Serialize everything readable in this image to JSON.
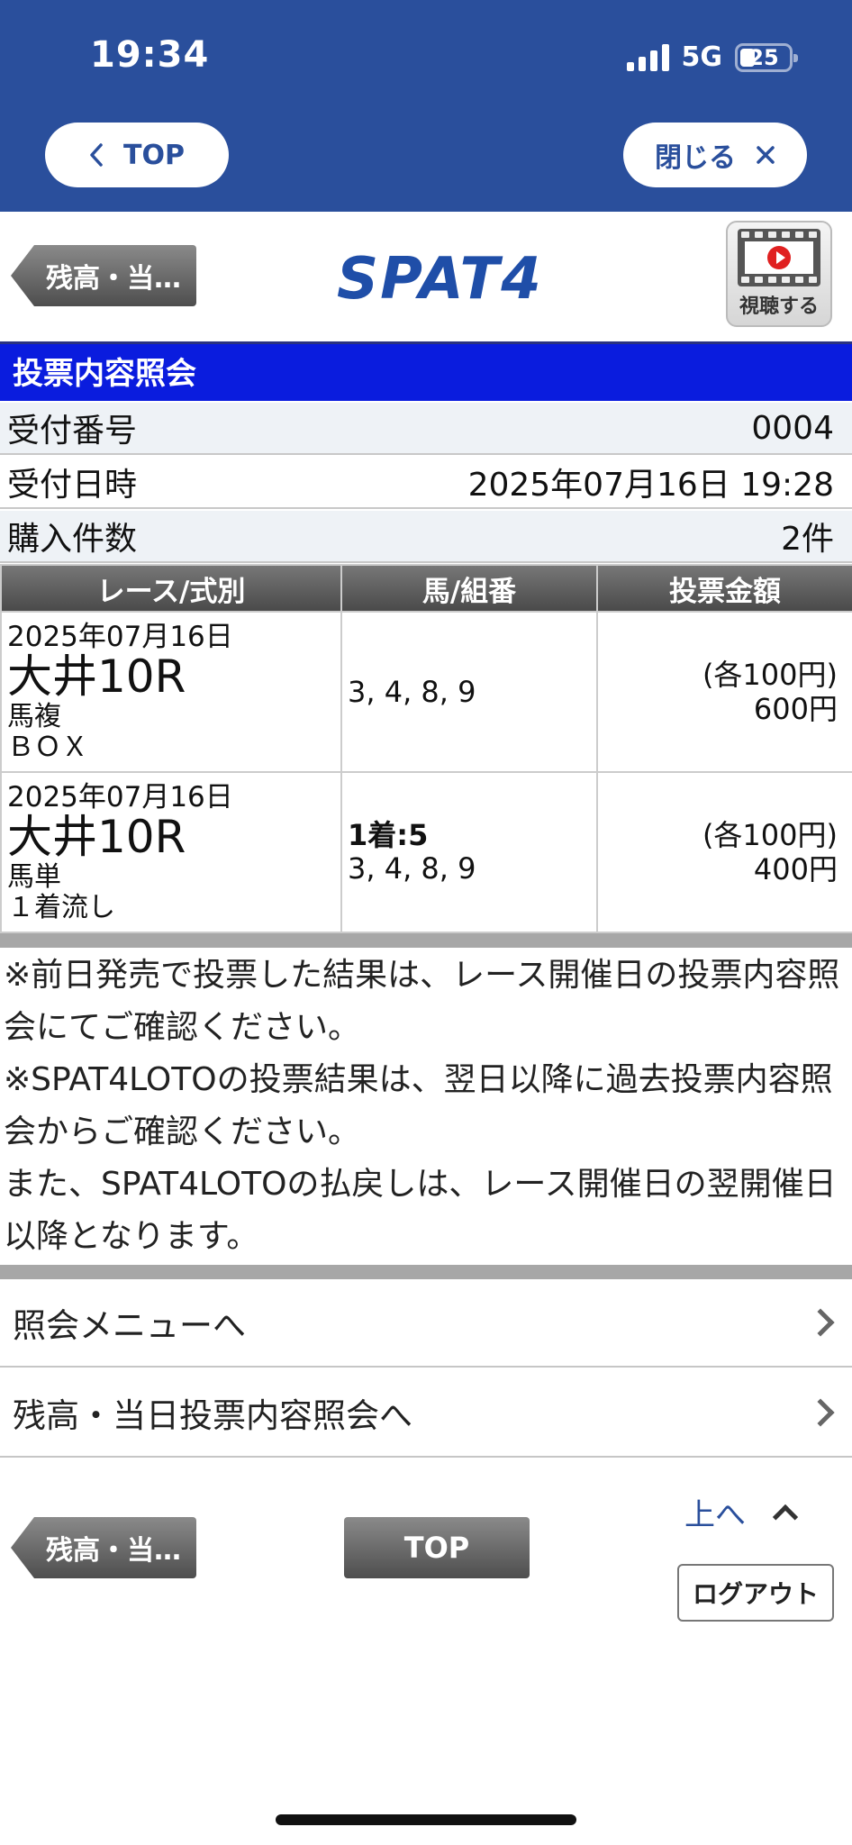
{
  "status_bar": {
    "time": "19:34",
    "network": "5G",
    "battery": "25"
  },
  "browser": {
    "top_label": "TOP",
    "close_label": "閉じる"
  },
  "header": {
    "back_label": "残高・当…",
    "logo": "SPAT4",
    "watch_label": "視聴する"
  },
  "section_title": "投票内容照会",
  "info": [
    {
      "label": "受付番号",
      "value": "0004"
    },
    {
      "label": "受付日時",
      "value": "2025年07月16日 19:28"
    },
    {
      "label": "購入件数",
      "value": "2件"
    }
  ],
  "table": {
    "headers": [
      "レース/式別",
      "馬/組番",
      "投票金額"
    ],
    "rows": [
      {
        "date": "2025年07月16日",
        "venue": "大井10R",
        "type": "馬複",
        "method": "ＢＯＸ",
        "anchor": "",
        "combo": "3, 4, 8, 9",
        "unit": "(各100円)",
        "total": "600円"
      },
      {
        "date": "2025年07月16日",
        "venue": "大井10R",
        "type": "馬単",
        "method": "１着流し",
        "anchor": "1着:5",
        "combo": "3, 4, 8, 9",
        "unit": "(各100円)",
        "total": "400円"
      }
    ]
  },
  "notes": [
    "※前日発売で投票した結果は、レース開催日の投票内容照会にてご確認ください。",
    "※SPAT4LOTOの投票結果は、翌日以降に過去投票内容照会からご確認ください。",
    "また、SPAT4LOTOの払戻しは、レース開催日の翌開催日以降となります。"
  ],
  "menu": [
    {
      "label": "照会メニューへ"
    },
    {
      "label": "残高・当日投票内容照会へ"
    }
  ],
  "footer": {
    "back_label": "残高・当…",
    "top_label": "TOP",
    "up_label": "上へ",
    "logout_label": "ログアウト"
  },
  "colors": {
    "chrome": "#2a4f9c",
    "section_title": "#0a1cde",
    "logo": "#1f4ea8"
  }
}
